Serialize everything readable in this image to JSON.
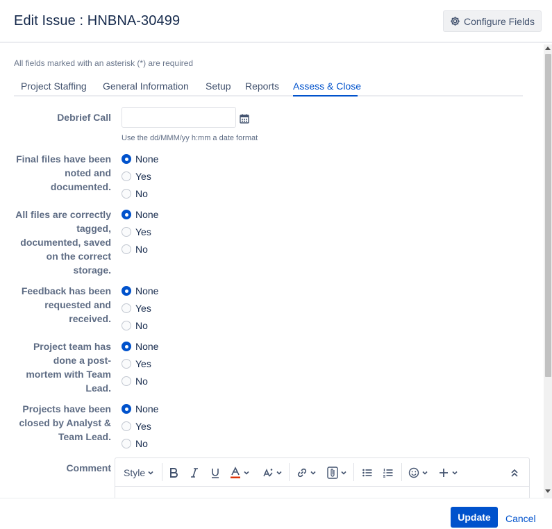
{
  "header": {
    "title": "Edit Issue : HNBNA-30499",
    "configure_label": "Configure Fields",
    "configure_icon": "gear-icon"
  },
  "form": {
    "required_note": "All fields marked with an asterisk (*) are required",
    "tabs": [
      {
        "label": "Project Staffing",
        "active": false
      },
      {
        "label": "General Information",
        "active": false
      },
      {
        "label": "Setup",
        "active": false
      },
      {
        "label": "Reports",
        "active": false
      },
      {
        "label": "Assess & Close",
        "active": true
      }
    ],
    "debrief": {
      "label": "Debrief Call",
      "value": "",
      "hint": "Use the dd/MMM/yy h:mm a date format",
      "icon": "calendar-icon"
    },
    "radio_options": [
      "None",
      "Yes",
      "No"
    ],
    "questions": [
      {
        "label_lines": [
          "Final files have been",
          "noted and",
          "documented."
        ],
        "selected": "None"
      },
      {
        "label_lines": [
          "All files are correctly",
          "tagged,",
          "documented, saved",
          "on the correct",
          "storage."
        ],
        "selected": "None"
      },
      {
        "label_lines": [
          "Feedback has been",
          "requested and",
          "received."
        ],
        "selected": "None"
      },
      {
        "label_lines": [
          "Project team has",
          "done a post-",
          "mortem with Team",
          "Lead."
        ],
        "selected": "None"
      },
      {
        "label_lines": [
          "Projects have been",
          "closed by Analyst &",
          "Team Lead."
        ],
        "selected": "None"
      }
    ],
    "comment_label": "Comment",
    "editor_toolbar": {
      "style_label": "Style"
    }
  },
  "footer": {
    "update_label": "Update",
    "cancel_label": "Cancel"
  },
  "colors": {
    "primary": "#0052cc",
    "text": "#172b4d",
    "label": "#5e6c84"
  }
}
